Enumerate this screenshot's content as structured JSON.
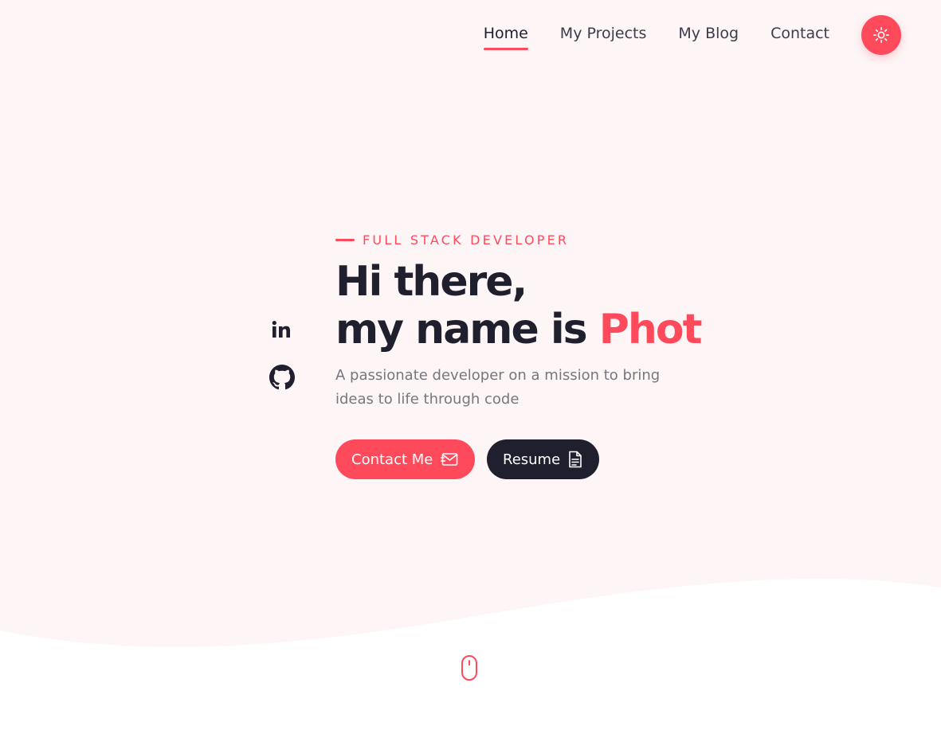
{
  "nav": {
    "items": [
      {
        "label": "Home",
        "active": true
      },
      {
        "label": "My Projects",
        "active": false
      },
      {
        "label": "My Blog",
        "active": false
      },
      {
        "label": "Contact",
        "active": false
      }
    ],
    "theme_toggle_icon": "sun-icon"
  },
  "social": {
    "icons": [
      "linkedin-icon",
      "github-icon"
    ]
  },
  "hero": {
    "eyebrow": "FULL STACK DEVELOPER",
    "headline_line1": "Hi there,",
    "headline_line2_prefix": "my name is ",
    "headline_name": "Phot",
    "subtitle": "A passionate developer on a mission to bring ideas to life through code",
    "buttons": {
      "contact_label": "Contact Me",
      "contact_icon": "envelope-icon",
      "resume_label": "Resume",
      "resume_icon": "document-icon"
    }
  },
  "scroll_indicator_icon": "mouse-icon",
  "colors": {
    "accent": "#ff4a5c",
    "dark": "#201f2e",
    "background": "#fdf5f6",
    "muted_text": "#77767e"
  }
}
